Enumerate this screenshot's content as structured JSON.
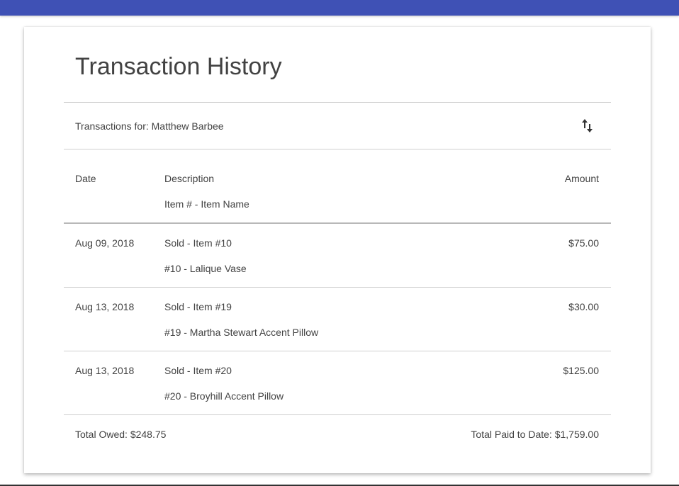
{
  "colors": {
    "app_bar": "#3f51b5",
    "text": "#424242",
    "divider": "#cfcfcf"
  },
  "card": {
    "title": "Transaction History",
    "subheader": "Transactions for: Matthew Barbee",
    "sort_icon": "swap-vertical-icon"
  },
  "table": {
    "headers": {
      "date": "Date",
      "description": "Description",
      "description_sub": "Item # - Item Name",
      "amount": "Amount"
    },
    "rows": [
      {
        "date": "Aug 09, 2018",
        "description": "Sold - Item #10",
        "item": "#10 - Lalique Vase",
        "amount": "$75.00"
      },
      {
        "date": "Aug 13, 2018",
        "description": "Sold - Item #19",
        "item": "#19 - Martha Stewart Accent Pillow",
        "amount": "$30.00"
      },
      {
        "date": "Aug 13, 2018",
        "description": "Sold - Item #20",
        "item": "#20 - Broyhill Accent Pillow",
        "amount": "$125.00"
      }
    ]
  },
  "footer": {
    "total_owed": "Total Owed: $248.75",
    "total_paid": "Total Paid to Date: $1,759.00"
  }
}
